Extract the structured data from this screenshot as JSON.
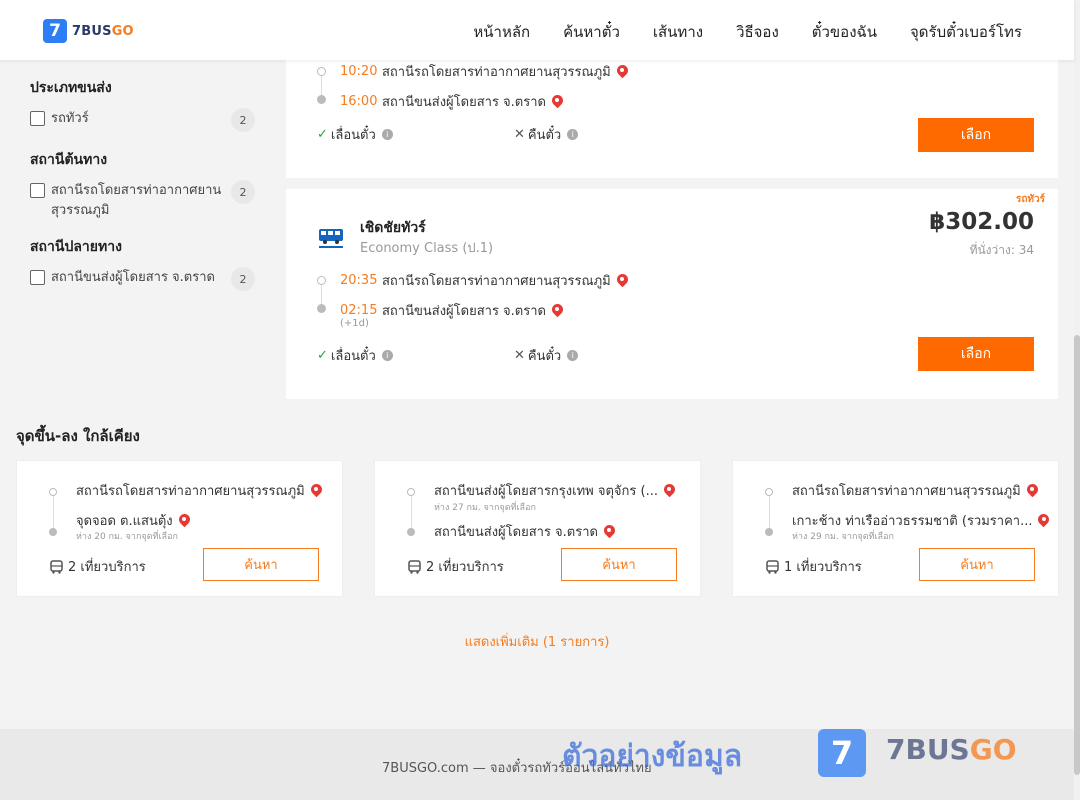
{
  "header": {
    "logo_mark": "7",
    "logo_brand": "7BUS",
    "logo_brand_accent": "GO",
    "nav": [
      "หน้าหลัก",
      "ค้นหาตั๋ว",
      "เส้นทาง",
      "วิธีจอง",
      "ตั๋วของฉัน",
      "จุดรับตั๋วเบอร์โทร"
    ]
  },
  "filters": {
    "transport_type": {
      "title": "ประเภทขนส่ง",
      "options": [
        {
          "label": "รถทัวร์",
          "count": "2"
        }
      ]
    },
    "origin": {
      "title": "สถานีต้นทาง",
      "options": [
        {
          "label": "สถานีรถโดยสารท่าอากาศยานสุวรรณภูมิ",
          "count": "2"
        }
      ]
    },
    "destination": {
      "title": "สถานีปลายทาง",
      "options": [
        {
          "label": "สถานีขนส่งผู้โดยสาร จ.ตราด",
          "count": "2"
        }
      ]
    }
  },
  "results": [
    {
      "depart_time": "10:20",
      "depart_station": "สถานีรถโดยสารท่าอากาศยานสุวรรณภูมิ",
      "arrive_time": "16:00",
      "arrive_station": "สถานีขนส่งผู้โดยสาร จ.ตราด",
      "reschedule": "เลื่อนตั๋ว",
      "refund": "คืนตั๋ว",
      "select_label": "เลือก"
    },
    {
      "tag": "รถทัวร์",
      "operator": "เชิดชัยทัวร์",
      "class": "Economy Class (ป.1)",
      "price": "฿302.00",
      "seats": "ที่นั่งว่าง: 34",
      "depart_time": "20:35",
      "depart_station": "สถานีรถโดยสารท่าอากาศยานสุวรรณภูมิ",
      "arrive_time": "02:15",
      "arrive_station": "สถานีขนส่งผู้โดยสาร จ.ตราด",
      "plus_day": "(+1d)",
      "reschedule": "เลื่อนตั๋ว",
      "refund": "คืนตั๋ว",
      "select_label": "เลือก"
    }
  ],
  "nearby": {
    "title": "จุดขึ้น-ลง ใกล้เคียง",
    "cards": [
      {
        "from": "สถานีรถโดยสารท่าอากาศยานสุวรรณภูมิ",
        "to": "จุดจอด ต.แสนตุ้ง",
        "to_sub": "ห่าง 20 กม. จากจุดที่เลือก",
        "trips": "2 เที่ยวบริการ",
        "button": "ค้นหา"
      },
      {
        "from": "สถานีขนส่งผู้โดยสารกรุงเทพ จตุจักร (...",
        "from_sub": "ห่าง 27 กม. จากจุดที่เลือก",
        "to": "สถานีขนส่งผู้โดยสาร จ.ตราด",
        "trips": "2 เที่ยวบริการ",
        "button": "ค้นหา"
      },
      {
        "from": "สถานีรถโดยสารท่าอากาศยานสุวรรณภูมิ",
        "to": "เกาะช้าง ท่าเรืออ่าวธรรมชาติ (รวมราคา...",
        "to_sub": "ห่าง 29 กม. จากจุดที่เลือก",
        "trips": "1 เที่ยวบริการ",
        "button": "ค้นหา"
      }
    ]
  },
  "show_more": "แสดงเพิ่มเติม (1 รายการ)",
  "footer": {
    "text": "7BUSGO.com — จองตั๋วรถทัวร์ออนไลน์ทั่วไทย",
    "watermark": "ตัวอย่างข้อมูล",
    "wm_mark": "7",
    "wm_brand": "7BUS",
    "wm_brand_accent": "GO"
  },
  "colors": {
    "accent": "#ff6a00",
    "brand_blue": "#2d7ef5",
    "time": "#f57c1f",
    "pin": "#e53935"
  },
  "icons": [
    "map-pin-icon",
    "check-icon",
    "cross-icon",
    "info-icon",
    "bus-icon",
    "checkbox-icon"
  ]
}
